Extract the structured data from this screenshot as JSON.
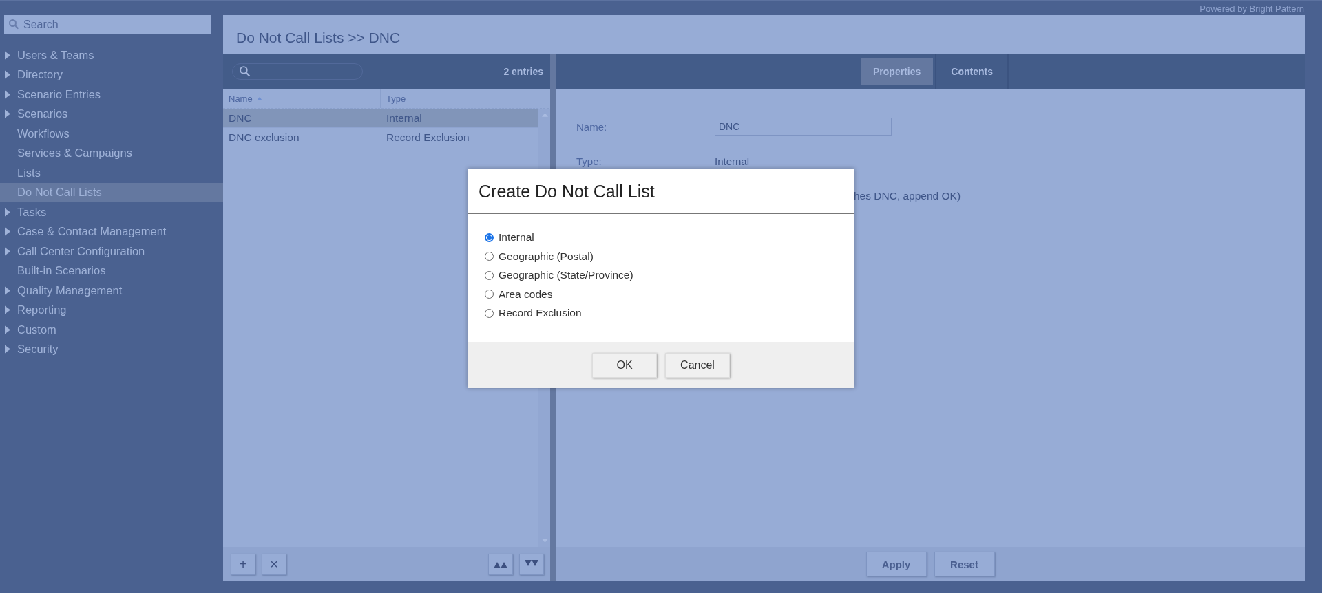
{
  "branding": "Powered by Bright Pattern",
  "sidebar": {
    "search": {
      "placeholder": "Search"
    },
    "items": [
      {
        "label": "Users & Teams",
        "expandable": true,
        "selected": false
      },
      {
        "label": "Directory",
        "expandable": true,
        "selected": false
      },
      {
        "label": "Scenario Entries",
        "expandable": true,
        "selected": false
      },
      {
        "label": "Scenarios",
        "expandable": true,
        "selected": false
      },
      {
        "label": "Workflows",
        "expandable": false,
        "selected": false
      },
      {
        "label": "Services & Campaigns",
        "expandable": false,
        "selected": false
      },
      {
        "label": "Lists",
        "expandable": false,
        "selected": false
      },
      {
        "label": "Do Not Call Lists",
        "expandable": false,
        "selected": true
      },
      {
        "label": "Tasks",
        "expandable": true,
        "selected": false
      },
      {
        "label": "Case & Contact Management",
        "expandable": true,
        "selected": false
      },
      {
        "label": "Call Center Configuration",
        "expandable": true,
        "selected": false
      },
      {
        "label": "Built-in Scenarios",
        "expandable": false,
        "selected": false
      },
      {
        "label": "Quality Management",
        "expandable": true,
        "selected": false
      },
      {
        "label": "Reporting",
        "expandable": true,
        "selected": false
      },
      {
        "label": "Custom",
        "expandable": true,
        "selected": false
      },
      {
        "label": "Security",
        "expandable": true,
        "selected": false
      }
    ]
  },
  "header": {
    "title": "Do Not Call Lists >> DNC"
  },
  "list": {
    "entries": "2 entries",
    "columns": [
      {
        "label": "Name",
        "sorted": true
      },
      {
        "label": "Type",
        "sorted": false
      }
    ],
    "rows": [
      {
        "name": "DNC",
        "type": "Internal",
        "selected": true
      },
      {
        "name": "DNC exclusion",
        "type": "Record Exclusion",
        "selected": false
      }
    ],
    "buttons": [
      {
        "kind": "add",
        "label": "+"
      },
      {
        "kind": "delete",
        "label": "×"
      },
      {
        "kind": "move_up"
      },
      {
        "kind": "move_down"
      }
    ]
  },
  "details": {
    "tabs": [
      {
        "label": "Properties",
        "selected": true
      },
      {
        "label": "Contents",
        "selected": false
      }
    ],
    "fields": [
      {
        "kind": "input",
        "label": "Name:",
        "value": "DNC"
      },
      {
        "kind": "text",
        "label": "Type:",
        "value": "Internal"
      },
      {
        "kind": "note",
        "value": "hes DNC, append OK)"
      }
    ],
    "buttons": [
      "Apply",
      "Reset"
    ]
  },
  "dialog": {
    "title": "Create Do Not Call List",
    "options": [
      {
        "label": "Internal",
        "selected": true
      },
      {
        "label": "Geographic (Postal)",
        "selected": false
      },
      {
        "label": "Geographic (State/Province)",
        "selected": false
      },
      {
        "label": "Area codes",
        "selected": false
      },
      {
        "label": "Record Exclusion",
        "selected": false
      }
    ],
    "buttons": [
      "OK",
      "Cancel"
    ]
  }
}
